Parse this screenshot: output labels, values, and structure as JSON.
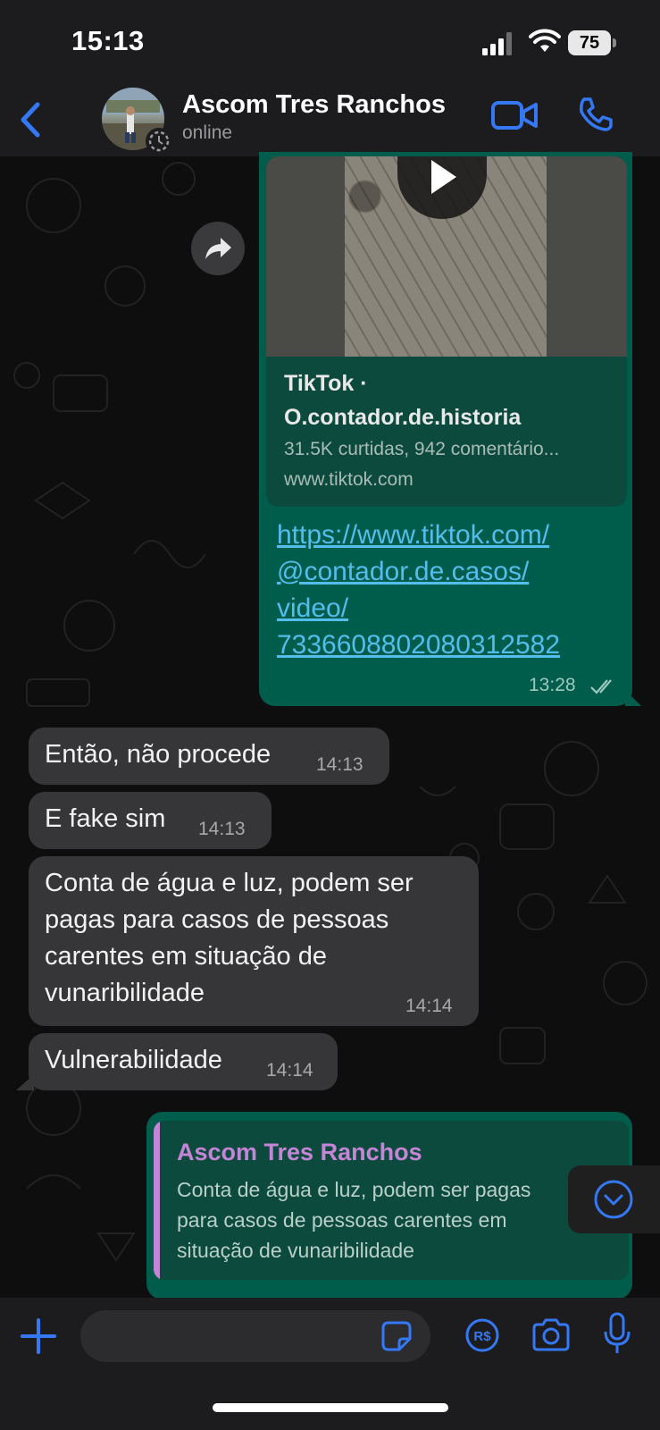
{
  "status_bar": {
    "time": "15:13",
    "battery": "75"
  },
  "header": {
    "contact_name": "Ascom Tres Ranchos",
    "contact_status": "online",
    "icons": [
      "back-icon",
      "video-call-icon",
      "phone-icon"
    ]
  },
  "messages": {
    "link_message": {
      "preview_site": "TikTok ·",
      "preview_title": "O.contador.de.historia",
      "preview_desc": "31.5K curtidas, 942 comentário...",
      "preview_url": "www.tiktok.com",
      "link_lines": [
        "https://www.tiktok.com/",
        "@contador.de.casos/",
        "video/",
        "7336608802080312582"
      ],
      "time": "13:28"
    },
    "incoming": [
      {
        "text": "Então, não procede",
        "time": "14:13"
      },
      {
        "text": "E fake sim",
        "time": "14:13"
      },
      {
        "lines": [
          "Conta de água e luz, podem ser",
          "pagas para casos de pessoas",
          "carentes em situação de",
          "vunaribilidade"
        ],
        "time": "14:14"
      },
      {
        "text": "Vulnerabilidade",
        "time": "14:14"
      }
    ],
    "reply_message": {
      "quoted_author": "Ascom Tres Ranchos",
      "quoted_lines": [
        "Conta de água e luz, podem ser pagas",
        "para casos de pessoas carentes em",
        "situação de vunaribilidade"
      ]
    }
  },
  "colors": {
    "outgoing_bubble": "#005c4b",
    "incoming_bubble": "#363638",
    "accent": "#3478f6",
    "link": "#53bdeb",
    "quote_author": "#c585d6"
  }
}
